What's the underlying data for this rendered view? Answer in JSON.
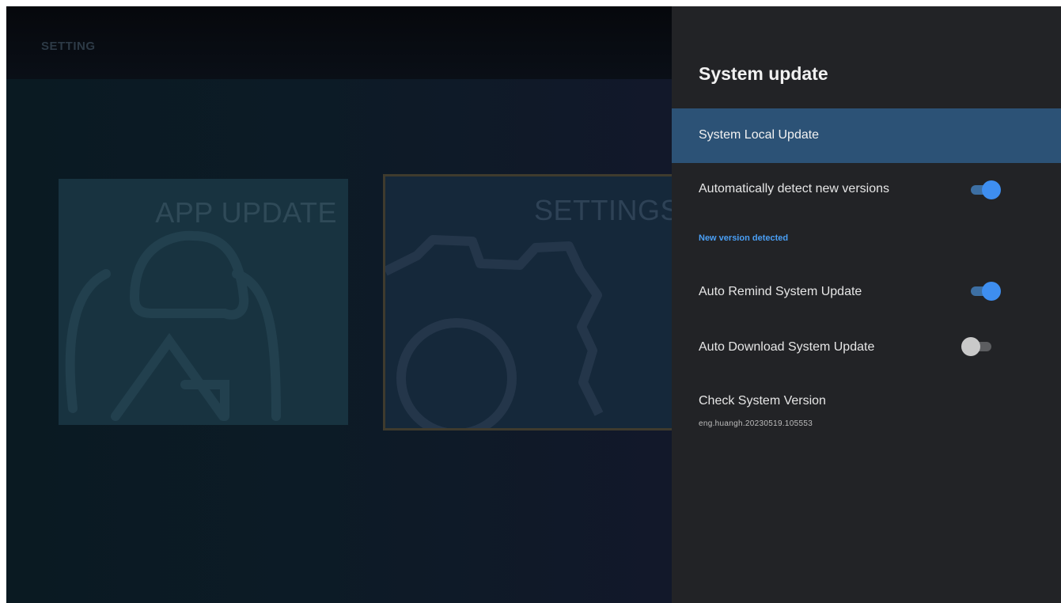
{
  "background": {
    "header_title": "SETTING",
    "tiles": [
      {
        "label": "APP UPDATE",
        "icon": "app-update-icon"
      },
      {
        "label": "SETTINGS",
        "icon": "gear-icon"
      }
    ]
  },
  "panel": {
    "title": "System update",
    "items": {
      "local_update": {
        "label": "System Local Update"
      },
      "auto_detect": {
        "label": "Automatically detect new versions",
        "enabled": true
      },
      "new_version_note": "New version detected",
      "auto_remind": {
        "label": "Auto Remind System Update",
        "enabled": true
      },
      "auto_download": {
        "label": "Auto Download System Update",
        "enabled": false
      },
      "check_version": {
        "label": "Check System Version",
        "value": "eng.huangh.20230519.105553"
      }
    }
  },
  "colors": {
    "accent": "#3e8ef0",
    "selected_row": "#2c5276",
    "panel_bg": "#222326"
  }
}
